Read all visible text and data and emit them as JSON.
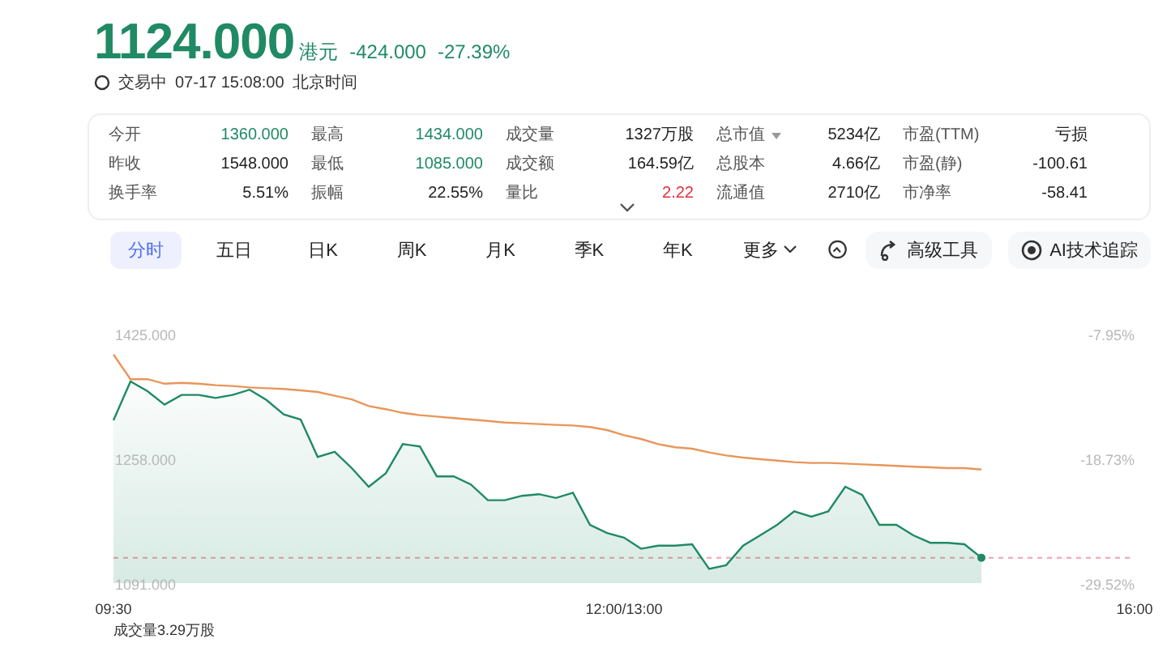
{
  "quote": {
    "price": "1124.000",
    "currency": "港元",
    "change": "-424.000",
    "change_pct": "-27.39%",
    "status": "交易中",
    "time": "07-17 15:08:00",
    "timezone": "北京时间"
  },
  "stats": [
    {
      "label": "今开",
      "value": "1360.000",
      "color": "#1f8a63"
    },
    {
      "label": "最高",
      "value": "1434.000",
      "color": "#1f8a63"
    },
    {
      "label": "成交量",
      "value": "1327万股",
      "color": "#222222"
    },
    {
      "label": "总市值",
      "value": "5234亿",
      "color": "#222222",
      "has_menu": true
    },
    {
      "label": "市盈(TTM)",
      "value": "亏损",
      "color": "#222222"
    },
    {
      "label": "昨收",
      "value": "1548.000",
      "color": "#222222"
    },
    {
      "label": "最低",
      "value": "1085.000",
      "color": "#1f8a63"
    },
    {
      "label": "成交额",
      "value": "164.59亿",
      "color": "#222222"
    },
    {
      "label": "总股本",
      "value": "4.66亿",
      "color": "#222222"
    },
    {
      "label": "市盈(静)",
      "value": "-100.61",
      "color": "#222222"
    },
    {
      "label": "换手率",
      "value": "5.51%",
      "color": "#222222"
    },
    {
      "label": "振幅",
      "value": "22.55%",
      "color": "#222222"
    },
    {
      "label": "量比",
      "value": "2.22",
      "color": "#e0303a"
    },
    {
      "label": "流通值",
      "value": "2710亿",
      "color": "#222222"
    },
    {
      "label": "市净率",
      "value": "-58.41",
      "color": "#222222"
    }
  ],
  "stats_expanded": false,
  "tabs": [
    {
      "label": "分时",
      "selected": true
    },
    {
      "label": "五日",
      "selected": false
    },
    {
      "label": "日K",
      "selected": false
    },
    {
      "label": "周K",
      "selected": false
    },
    {
      "label": "月K",
      "selected": false
    },
    {
      "label": "季K",
      "selected": false
    },
    {
      "label": "年K",
      "selected": false
    },
    {
      "label": "更多",
      "selected": false,
      "has_menu": true
    }
  ],
  "tools": [
    {
      "label": "高级工具",
      "kind": "tools"
    },
    {
      "label": "AI技术追踪",
      "kind": "ai"
    }
  ],
  "chart": {
    "chart_data": {
      "type": "area",
      "categories": [
        "09:30",
        null,
        null,
        null,
        null,
        null,
        null,
        null,
        null,
        null,
        null,
        null,
        null,
        null,
        null,
        null,
        null,
        null,
        null,
        null,
        null,
        null,
        null,
        null,
        null,
        null,
        null,
        null,
        null,
        null,
        "12:00/13:00",
        null,
        null,
        null,
        null,
        null,
        null,
        null,
        null,
        null,
        null,
        null,
        null,
        null,
        null,
        null,
        null,
        null,
        null,
        null,
        null,
        null,
        null,
        null,
        null,
        null,
        null,
        null,
        null,
        null,
        "16:00"
      ],
      "series": [
        {
          "color": "#1f8a63",
          "values": [
            1309,
            1361,
            1348,
            1330,
            1343,
            1343,
            1339,
            1343,
            1350,
            1336,
            1317,
            1310,
            1260,
            1267,
            1245,
            1220,
            1238,
            1277,
            1274,
            1234,
            1234,
            1223,
            1202,
            1202,
            1208,
            1210,
            1205,
            1212,
            1169,
            1158,
            1152,
            1137,
            1141,
            1141,
            1143,
            1110,
            1115,
            1141,
            1155,
            1169,
            1187,
            1180,
            1187,
            1220,
            1209,
            1169,
            1169,
            1155,
            1145,
            1145,
            1143,
            1125,
            null,
            null,
            null,
            null,
            null,
            null,
            null,
            null,
            null
          ]
        },
        {
          "color": "#e8965a",
          "type": "line",
          "values": [
            1397,
            1364,
            1364,
            1358,
            1359,
            1358,
            1356,
            1355,
            1353,
            1352,
            1351,
            1349,
            1347,
            1342,
            1337,
            1328,
            1324,
            1319,
            1316,
            1314,
            1312,
            1310,
            1308,
            1306,
            1305,
            1304,
            1303,
            1302,
            1300,
            1296,
            1289,
            1284,
            1277,
            1273,
            1271,
            1266,
            1262,
            1259,
            1257,
            1255,
            1253,
            1252,
            1252,
            1251,
            1250,
            1249,
            1248,
            1247,
            1246,
            1245,
            1245,
            1243,
            null,
            null,
            null,
            null,
            null,
            null,
            null,
            null,
            null
          ]
        }
      ],
      "ylim": [
        1091,
        1425
      ],
      "yticks": [
        {
          "value": 1425,
          "label": "1425.000"
        },
        {
          "value": 1258,
          "label": "1258.000"
        },
        {
          "value": 1091,
          "label": "1091.000"
        }
      ],
      "ref_lines": [
        {
          "axis": "y",
          "value": 1125
        }
      ]
    },
    "right_ticks": [
      "-7.95%",
      "-18.73%",
      "-29.52%"
    ],
    "volume_label": "成交量3.29万股"
  }
}
